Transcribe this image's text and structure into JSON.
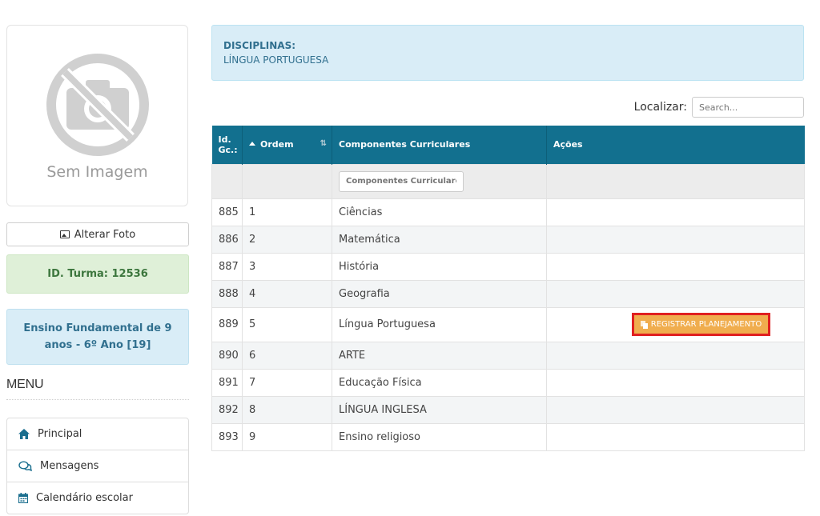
{
  "sidebar": {
    "photo_caption": "Sem Imagem",
    "change_photo_label": "Alterar Foto",
    "turma_label": "ID. Turma: 12536",
    "curso_label": "Ensino Fundamental de 9 anos - 6º Ano [19]",
    "menu_title": "MENU",
    "menu_items": [
      {
        "label": "Principal",
        "icon": "home-icon"
      },
      {
        "label": "Mensagens",
        "icon": "chat-icon"
      },
      {
        "label": "Calendário escolar",
        "icon": "calendar-icon"
      }
    ]
  },
  "disciplinas": {
    "title": "DISCIPLINAS:",
    "value": "LÍNGUA PORTUGUESA"
  },
  "search": {
    "label": "Localizar:",
    "placeholder": "Search..."
  },
  "table": {
    "headers": [
      "Id. Gc.:",
      "Ordem",
      "Componentes Curriculares",
      "Ações"
    ],
    "filter_placeholder": "Componentes Curriculares",
    "action_label": "REGISTRAR PLANEJAMENTO",
    "rows": [
      {
        "id": "885",
        "ordem": "1",
        "componente": "Ciências"
      },
      {
        "id": "886",
        "ordem": "2",
        "componente": "Matemática"
      },
      {
        "id": "887",
        "ordem": "3",
        "componente": "História"
      },
      {
        "id": "888",
        "ordem": "4",
        "componente": "Geografia"
      },
      {
        "id": "889",
        "ordem": "5",
        "componente": "Língua Portuguesa"
      },
      {
        "id": "890",
        "ordem": "6",
        "componente": "ARTE"
      },
      {
        "id": "891",
        "ordem": "7",
        "componente": "Educação Física"
      },
      {
        "id": "892",
        "ordem": "8",
        "componente": "LÍNGUA INGLESA"
      },
      {
        "id": "893",
        "ordem": "9",
        "componente": "Ensino religioso"
      }
    ]
  },
  "colors": {
    "header_bg": "#12708f",
    "action_button": "#f0ad4e",
    "highlight_border": "#e02020"
  }
}
